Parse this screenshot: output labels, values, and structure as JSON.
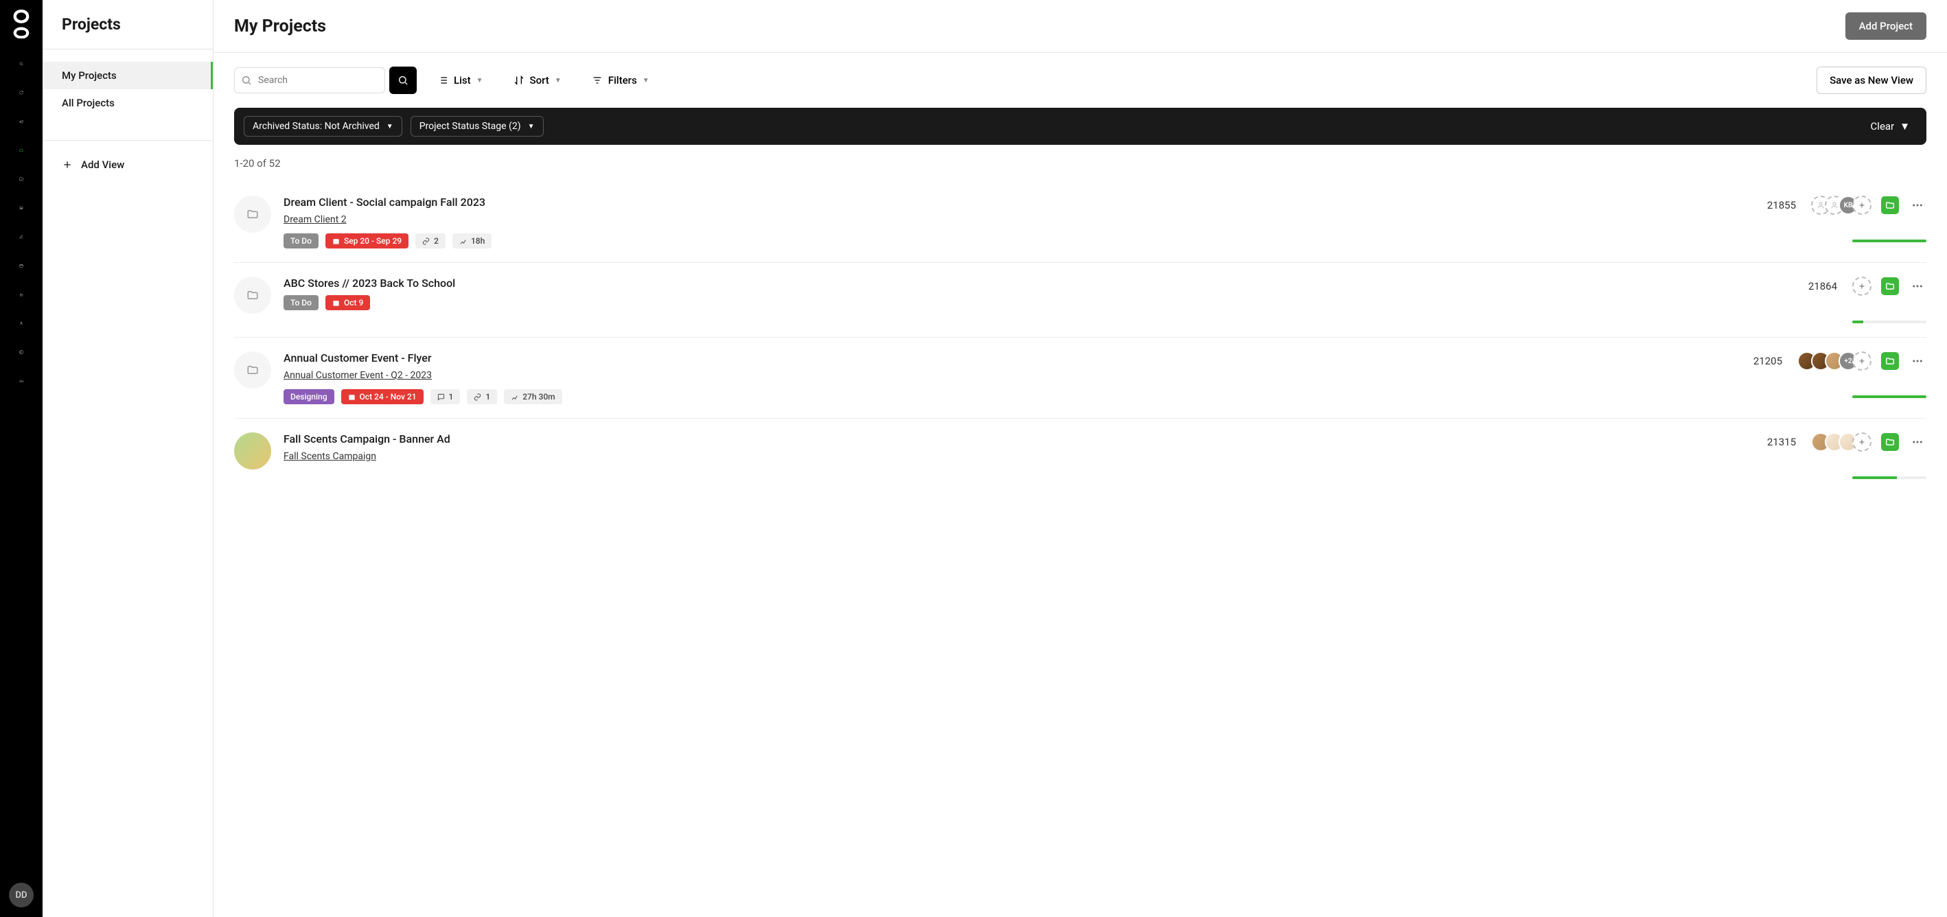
{
  "sidebar": {
    "title": "Projects",
    "nav": [
      {
        "label": "My Projects",
        "active": true
      },
      {
        "label": "All Projects",
        "active": false
      }
    ],
    "add_view": "Add View"
  },
  "header": {
    "title": "My Projects",
    "add_project": "Add Project"
  },
  "toolbar": {
    "search_placeholder": "Search",
    "list": "List",
    "sort": "Sort",
    "filters": "Filters",
    "save_view": "Save as New View"
  },
  "filter_bar": {
    "chips": [
      {
        "label": "Archived Status: Not Archived"
      },
      {
        "label": "Project Status Stage (2)"
      }
    ],
    "clear": "Clear"
  },
  "count_text": "1-20 of 52",
  "user_avatar": "DD",
  "projects": [
    {
      "title": "Dream Client - Social campaign Fall 2023",
      "sublink": "Dream Client 2",
      "id": "21855",
      "status": {
        "text": "To Do",
        "variant": "gray"
      },
      "date": "Sep 20 - Sep 29",
      "metas": [
        {
          "icon": "link",
          "text": "2"
        },
        {
          "icon": "level",
          "text": "18h"
        }
      ],
      "avatars": [
        {
          "kind": "dashed"
        },
        {
          "kind": "dashed"
        },
        {
          "kind": "kb",
          "text": "KB"
        }
      ],
      "progress": 100,
      "thumb": "folder"
    },
    {
      "title": "ABC Stores // 2023 Back To School",
      "sublink": null,
      "id": "21864",
      "status": {
        "text": "To Do",
        "variant": "gray"
      },
      "date": "Oct 9",
      "metas": [],
      "avatars": [],
      "progress": 15,
      "thumb": "folder"
    },
    {
      "title": "Annual Customer Event - Flyer",
      "sublink": "Annual Customer Event - Q2 - 2023",
      "id": "21205",
      "status": {
        "text": "Designing",
        "variant": "purple"
      },
      "date": "Oct 24 - Nov 21",
      "metas": [
        {
          "icon": "comment",
          "text": "1"
        },
        {
          "icon": "link",
          "text": "1"
        },
        {
          "icon": "level",
          "text": "27h 30m"
        }
      ],
      "avatars": [
        {
          "kind": "c1"
        },
        {
          "kind": "c1"
        },
        {
          "kind": "c2"
        },
        {
          "kind": "more",
          "text": "+2"
        }
      ],
      "progress": 100,
      "thumb": "folder"
    },
    {
      "title": "Fall Scents Campaign - Banner Ad",
      "sublink": "Fall Scents Campaign",
      "id": "21315",
      "status": null,
      "date": null,
      "metas": [],
      "avatars": [
        {
          "kind": "c2"
        },
        {
          "kind": "c3"
        },
        {
          "kind": "c3"
        }
      ],
      "progress": 60,
      "thumb": "img"
    }
  ]
}
